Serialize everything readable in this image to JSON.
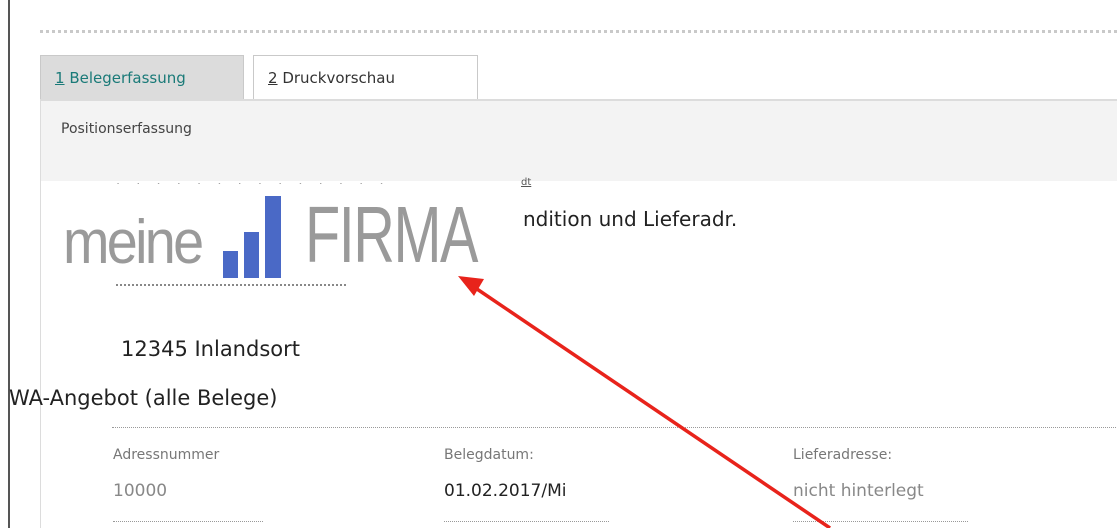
{
  "tabs": {
    "tab1_number": "1",
    "tab1_label": " Belegerfassung",
    "tab2_number": "2",
    "tab2_label": " Druckvorschau"
  },
  "panel": {
    "title": "Positionserfassung",
    "partial_label": "dt",
    "condition_text": "ndition und Lieferadr."
  },
  "logo": {
    "prefix": "meine",
    "name": "FIRMA",
    "bar_color": "#4a69c6",
    "text_color": "#9a9a9a"
  },
  "address": {
    "city": "12345 Inlandsort"
  },
  "document": {
    "title": "WA-Angebot (alle Belege)"
  },
  "fields": [
    {
      "label": "Adressnummer",
      "value": "10000",
      "muted": true
    },
    {
      "label": "Belegdatum:",
      "value": "01.02.2017/Mi",
      "muted": false
    },
    {
      "label": "Lieferadresse:",
      "value": "nicht hinterlegt",
      "muted": true
    }
  ],
  "colors": {
    "active_tab_text": "#1a7a78",
    "arrow": "#e8231b"
  }
}
